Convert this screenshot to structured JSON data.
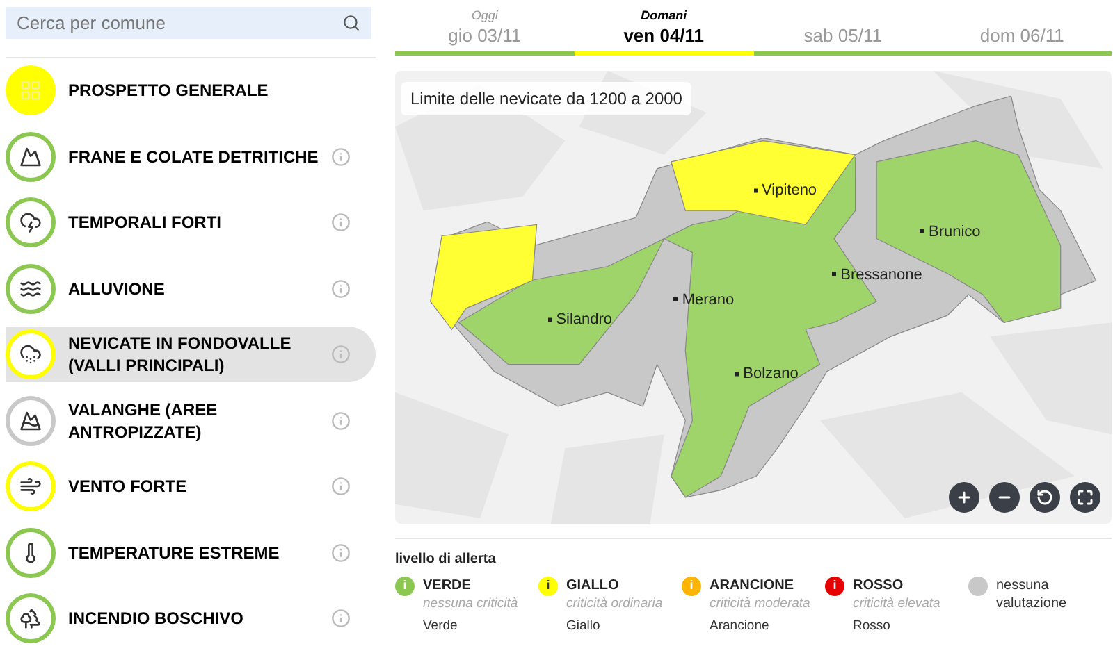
{
  "search": {
    "placeholder": "Cerca per comune"
  },
  "hazards": [
    {
      "kind": "overview",
      "label": "PROSPETTO GENERALE",
      "color": "#ffff00",
      "selected": false
    },
    {
      "kind": "landslide",
      "label": "FRANE E COLATE DETRITICHE",
      "color": "#8cc751",
      "selected": false
    },
    {
      "kind": "storm",
      "label": "TEMPORALI FORTI",
      "color": "#8cc751",
      "selected": false
    },
    {
      "kind": "flood",
      "label": "ALLUVIONE",
      "color": "#8cc751",
      "selected": false
    },
    {
      "kind": "snow",
      "label": "NEVICATE IN FONDOVALLE (VALLI PRINCIPALI)",
      "color": "#ffff00",
      "selected": true
    },
    {
      "kind": "avalanche",
      "label": "VALANGHE (AREE ANTROPIZZATE)",
      "color": "#c8c8c8",
      "selected": false
    },
    {
      "kind": "wind",
      "label": "VENTO FORTE",
      "color": "#ffff00",
      "selected": false
    },
    {
      "kind": "temperature",
      "label": "TEMPERATURE ESTREME",
      "color": "#8cc751",
      "selected": false
    },
    {
      "kind": "fire",
      "label": "INCENDIO BOSCHIVO",
      "color": "#8cc751",
      "selected": false
    }
  ],
  "days": [
    {
      "caption": "Oggi",
      "label": "gio 03/11",
      "color": "#8cc751",
      "selected": false
    },
    {
      "caption": "Domani",
      "label": "ven 04/11",
      "color": "#ffff00",
      "selected": true
    },
    {
      "label": "sab 05/11",
      "color": "#8cc751",
      "selected": false
    },
    {
      "label": "dom 06/11",
      "color": "#8cc751",
      "selected": false
    }
  ],
  "map": {
    "note": "Limite delle nevicate da 1200 a 2000",
    "zones": [
      {
        "kind": "whole",
        "color": "#c8c8c8"
      },
      {
        "kind": "center",
        "color": "#9fd46a"
      },
      {
        "kind": "east",
        "color": "#9fd46a"
      },
      {
        "kind": "west",
        "color": "#ffff33"
      },
      {
        "kind": "north",
        "color": "#ffff33"
      }
    ],
    "places": [
      {
        "name": "Vipiteno"
      },
      {
        "name": "Brunico"
      },
      {
        "name": "Bressanone"
      },
      {
        "name": "Merano"
      },
      {
        "name": "Silandro"
      },
      {
        "name": "Bolzano"
      }
    ]
  },
  "legend": {
    "title": "livello di allerta",
    "levels": [
      {
        "color": "#8cc751",
        "icon": "i",
        "name": "VERDE",
        "description": "nessuna criticità",
        "note": "Verde"
      },
      {
        "color": "#ffff00",
        "icon": "i",
        "name": "GIALLO",
        "description": "criticità ordinaria",
        "note": "Giallo"
      },
      {
        "color": "#ffb400",
        "icon": "i",
        "name": "ARANCIONE",
        "description": "criticità moderata",
        "note": "Arancione"
      },
      {
        "color": "#e60000",
        "icon": "i",
        "name": "ROSSO",
        "description": "criticità elevata",
        "note": "Rosso"
      },
      {
        "color": "#c8c8c8",
        "name": "nessuna valutazione"
      }
    ]
  }
}
